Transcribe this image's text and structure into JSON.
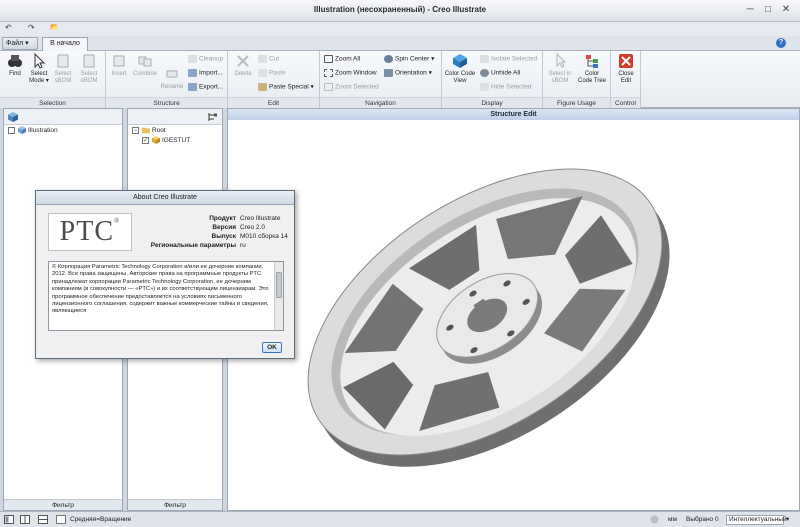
{
  "window": {
    "title": "Illustration (несохраненный) - Creo Illustrate",
    "minimize": "─",
    "maximize": "□",
    "close": "✕"
  },
  "qat": {
    "undo": "↶",
    "redo": "↷",
    "open": "📂"
  },
  "tabs": {
    "file": "Файл ▾",
    "home": "В начало",
    "help": "?"
  },
  "ribbon": {
    "groups": {
      "selection": "Selection",
      "structure": "Structure",
      "edit": "Edit",
      "navigation": "Navigation",
      "display": "Display",
      "figure_usage": "Figure Usage",
      "control": "Control"
    },
    "find": "Find",
    "select_mode": "Select Mode ▾",
    "select_sbom": "Select sBOM",
    "select_ebom": "Select eBOM",
    "insert": "Insert",
    "combine": "Combine",
    "rename": "Rename",
    "cleanup": "Cleanup",
    "import": "Import...",
    "export": "Export...",
    "delete": "Delete",
    "cut": "Cut",
    "paste": "Paste",
    "paste_special": "Paste Special ▾",
    "zoom_all": "Zoom All",
    "zoom_window": "Zoom Window",
    "zoom_selected": "Zoom Selected",
    "spin_center": "Spin Center ▾",
    "orientation": "Orientation ▾",
    "color_code_view": "Color Code View",
    "isolate_selected": "Isolate Selected",
    "unhide_all": "Unhide All",
    "hide_selected": "Hide Selected",
    "select_in_sbom": "Select in sBOM",
    "color_code_tree": "Color Code Tree",
    "close_edit": "Close Edit"
  },
  "left_panel": {
    "item": "Illustration",
    "footer": "Фильтр"
  },
  "tree_panel": {
    "root": "Root",
    "child": "IGESTUT",
    "footer": "Фильтр"
  },
  "viewport": {
    "title": "Structure Edit"
  },
  "dialog": {
    "title": "About Creo Illustrate",
    "logo": "PTC",
    "logo_mark": "®",
    "rows": [
      {
        "label": "Продукт",
        "value": "Creo Illustrate"
      },
      {
        "label": "Версия",
        "value": "Creo 2.0"
      },
      {
        "label": "Выпуск",
        "value": "M010 сборка 14"
      },
      {
        "label": "Региональные параметры",
        "value": "ru"
      }
    ],
    "text": "© Корпорация Parametric Technology Corporation и/или ее дочерние компании, 2012. Все права защищены. Авторские права на программные продукты PTC принадлежат корпорации Parametric Technology Corporation, ее дочерним компаниям (в совокупности — «PTC») и их соответствующим лицензиарам. Это программное обеспечение предоставляется на условиях письменного лицензионного соглашения, содержит важные коммерческие тайны и сведения, являющиеся",
    "ok": "OK"
  },
  "status": {
    "nav_mode": "Средняя=Вращение",
    "units": "мм",
    "selected": "Выбрано 0",
    "filter": "Интеллектуальный"
  },
  "colors": {
    "accent": "#2f6fc6",
    "viewport_header": "#c6d6ec",
    "close_red": "#d23a2a"
  }
}
